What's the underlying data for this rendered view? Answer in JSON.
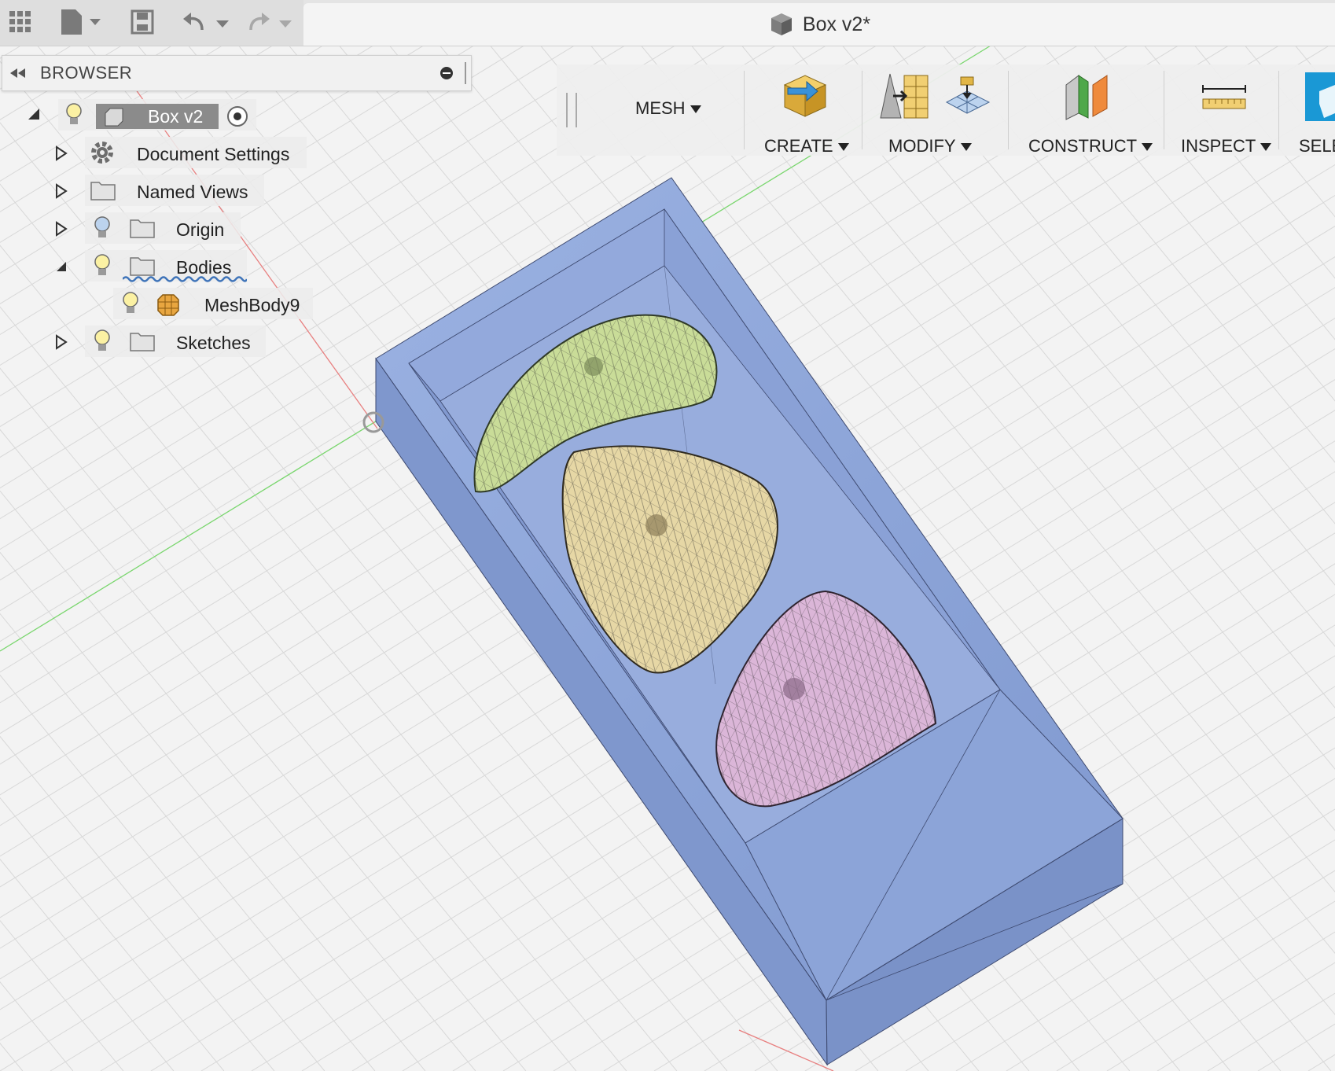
{
  "window": {
    "title": "Box v2*"
  },
  "browser": {
    "title": "BROWSER",
    "root": {
      "label": "Box v2"
    },
    "items": [
      {
        "label": "Document Settings",
        "icon": "gear-icon"
      },
      {
        "label": "Named Views",
        "icon": "folder-icon"
      },
      {
        "label": "Origin",
        "icon": "folder-icon"
      },
      {
        "label": "Bodies",
        "icon": "folder-icon"
      },
      {
        "label": "MeshBody9",
        "icon": "mesh-body-icon"
      },
      {
        "label": "Sketches",
        "icon": "folder-icon"
      }
    ]
  },
  "toolbar": {
    "workspace": "MESH",
    "groups": [
      {
        "label": "CREATE"
      },
      {
        "label": "MODIFY"
      },
      {
        "label": "CONSTRUCT"
      },
      {
        "label": "INSPECT"
      },
      {
        "label": "SELE"
      }
    ]
  },
  "colors": {
    "box": "#8da6d8",
    "mesh_green": "#c9dc98",
    "mesh_yellow": "#e6d7a5",
    "mesh_pink": "#dbb6d8",
    "axis_red": "#e88080",
    "axis_green": "#79d66d",
    "accent": "#1a98d5"
  }
}
